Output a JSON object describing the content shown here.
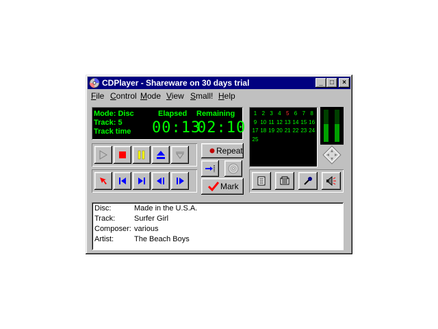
{
  "window": {
    "title": "CDPlayer - Shareware on 30 days trial",
    "controls": [
      "_",
      "□",
      "×"
    ]
  },
  "menu": [
    {
      "label": "File",
      "accel": "F",
      "rest": "ile"
    },
    {
      "label": "Control",
      "accel": "C",
      "rest": "ontrol"
    },
    {
      "label": "Mode",
      "accel": "M",
      "rest": "ode"
    },
    {
      "label": "View",
      "accel": "V",
      "rest": "iew"
    },
    {
      "label": "Small!",
      "accel": "S",
      "rest": "mall!"
    },
    {
      "label": "Help",
      "accel": "H",
      "rest": "elp"
    }
  ],
  "display": {
    "mode": "Mode: Disc",
    "track": "Track: 5",
    "track_time": "Track time",
    "elapsed_label": "Elapsed",
    "remaining_label": "Remaining",
    "elapsed": "00:13",
    "remaining": "02:10"
  },
  "tracklist": {
    "numbers": [
      "1",
      "2",
      "3",
      "4",
      "5",
      "6",
      "7",
      "8",
      "9",
      "10",
      "11",
      "12",
      "13",
      "14",
      "15",
      "16",
      "17",
      "18",
      "19",
      "20",
      "21",
      "22",
      "23",
      "24",
      "25"
    ],
    "current": "5"
  },
  "vu": {
    "left_level": 0.55,
    "right_level": 0.55
  },
  "buttons": {
    "repeat": "Repeat",
    "mark": "Mark"
  },
  "info": {
    "disc_label": "Disc:",
    "disc": "Made in the U.S.A.",
    "track_label": "Track:",
    "track": "Surfer Girl",
    "composer_label": "Composer:",
    "composer": "various",
    "artist_label": "Artist:",
    "artist": "The Beach Boys"
  },
  "colors": {
    "lcd_text": "#00ff00",
    "lcd_bg": "#000000",
    "current_track": "#ff3030",
    "title_bg": "#000080",
    "face": "#c0c0c0"
  },
  "icons": [
    "cd-icon",
    "play-icon",
    "stop-icon",
    "pause-icon",
    "eject-icon",
    "dropdown-icon",
    "goto-icon",
    "prev-track-icon",
    "next-track-icon",
    "rewind-icon",
    "fast-forward-icon",
    "intro-icon",
    "disc-icon",
    "checkmark-icon",
    "notes-icon",
    "database-icon",
    "microphone-icon",
    "speaker-icon",
    "pan-icon"
  ]
}
